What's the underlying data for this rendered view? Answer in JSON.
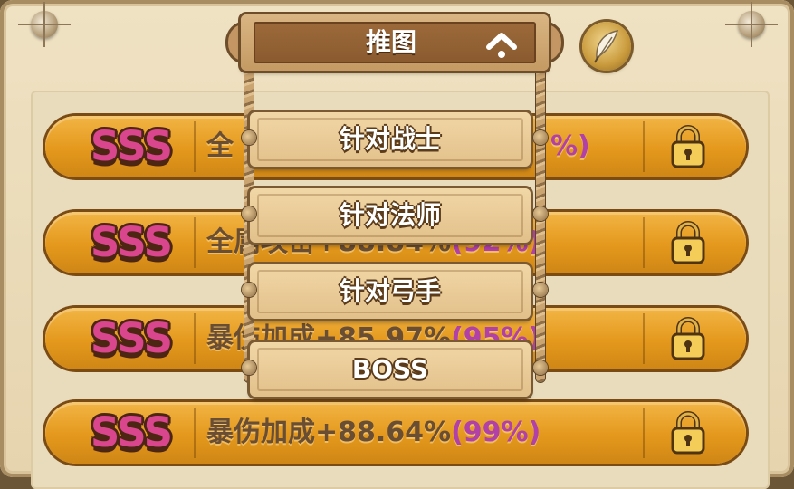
{
  "header": {
    "dropdown_label": "推图"
  },
  "menu": {
    "options": [
      {
        "label": "针对战士"
      },
      {
        "label": "针对法师"
      },
      {
        "label": "针对弓手"
      },
      {
        "label": "BOSS"
      }
    ]
  },
  "rows": [
    {
      "grade": "SSS",
      "stat": "全",
      "pct": "%)"
    },
    {
      "grade": "SSS",
      "stat": "全属攻击+88.84%",
      "pct": "(92%)"
    },
    {
      "grade": "SSS",
      "stat": "暴伤加成+85.97%",
      "pct": "(95%)"
    },
    {
      "grade": "SSS",
      "stat": "暴伤加成+88.64%",
      "pct": "(99%)"
    }
  ],
  "icons": {
    "top_left_pin": "pin-icon",
    "top_right_pin": "pin-icon",
    "quill": "feather-icon",
    "chevron": "chevron-up-icon",
    "lock": "padlock-icon"
  },
  "colors": {
    "grade": "#d9468d",
    "row_fill": "#e4981c",
    "pct": "#b140a7"
  }
}
